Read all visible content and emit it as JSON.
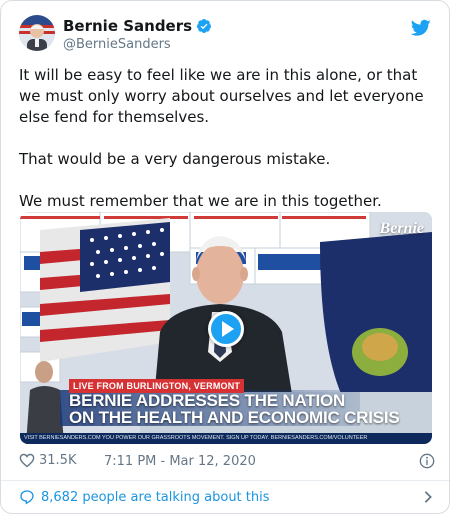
{
  "author": {
    "name": "Bernie Sanders",
    "handle": "@BernieSanders",
    "verified": true
  },
  "tweet": {
    "line1": "It will be easy to feel like we are in this alone, or that we must only worry about ourselves and let everyone else fend for themselves.",
    "line2": "That would be a very dangerous mistake.",
    "line3": "We must remember that we are in this together."
  },
  "media": {
    "live_tag": "LIVE FROM BURLINGTON, VERMONT",
    "headline_1": "BERNIE ADDRESSES THE NATION",
    "headline_2": "ON THE HEALTH AND ECONOMIC CRISIS",
    "ticker_left": "VISIT BERNIESANDERS.COM",
    "ticker_right": "YOU POWER OUR GRASSROOTS MOVEMENT. SIGN UP TODAY. BERNIESANDERS.COM/VOLUNTEER",
    "brand_logo": "Bernie"
  },
  "meta": {
    "likes": "31.5K",
    "timestamp": "7:11 PM - Mar 12, 2020"
  },
  "footer": {
    "talking": "8,682 people are talking about this"
  },
  "icons": {
    "verified": "verified-badge-icon",
    "twitter": "twitter-bird-icon",
    "like": "heart-icon",
    "info": "info-icon",
    "reply": "speech-bubble-icon",
    "more": "chevron-right-icon",
    "play": "play-icon"
  },
  "colors": {
    "accent": "#1da1f2",
    "link": "#1b95e0",
    "muted": "#657786",
    "text": "#14171a"
  }
}
